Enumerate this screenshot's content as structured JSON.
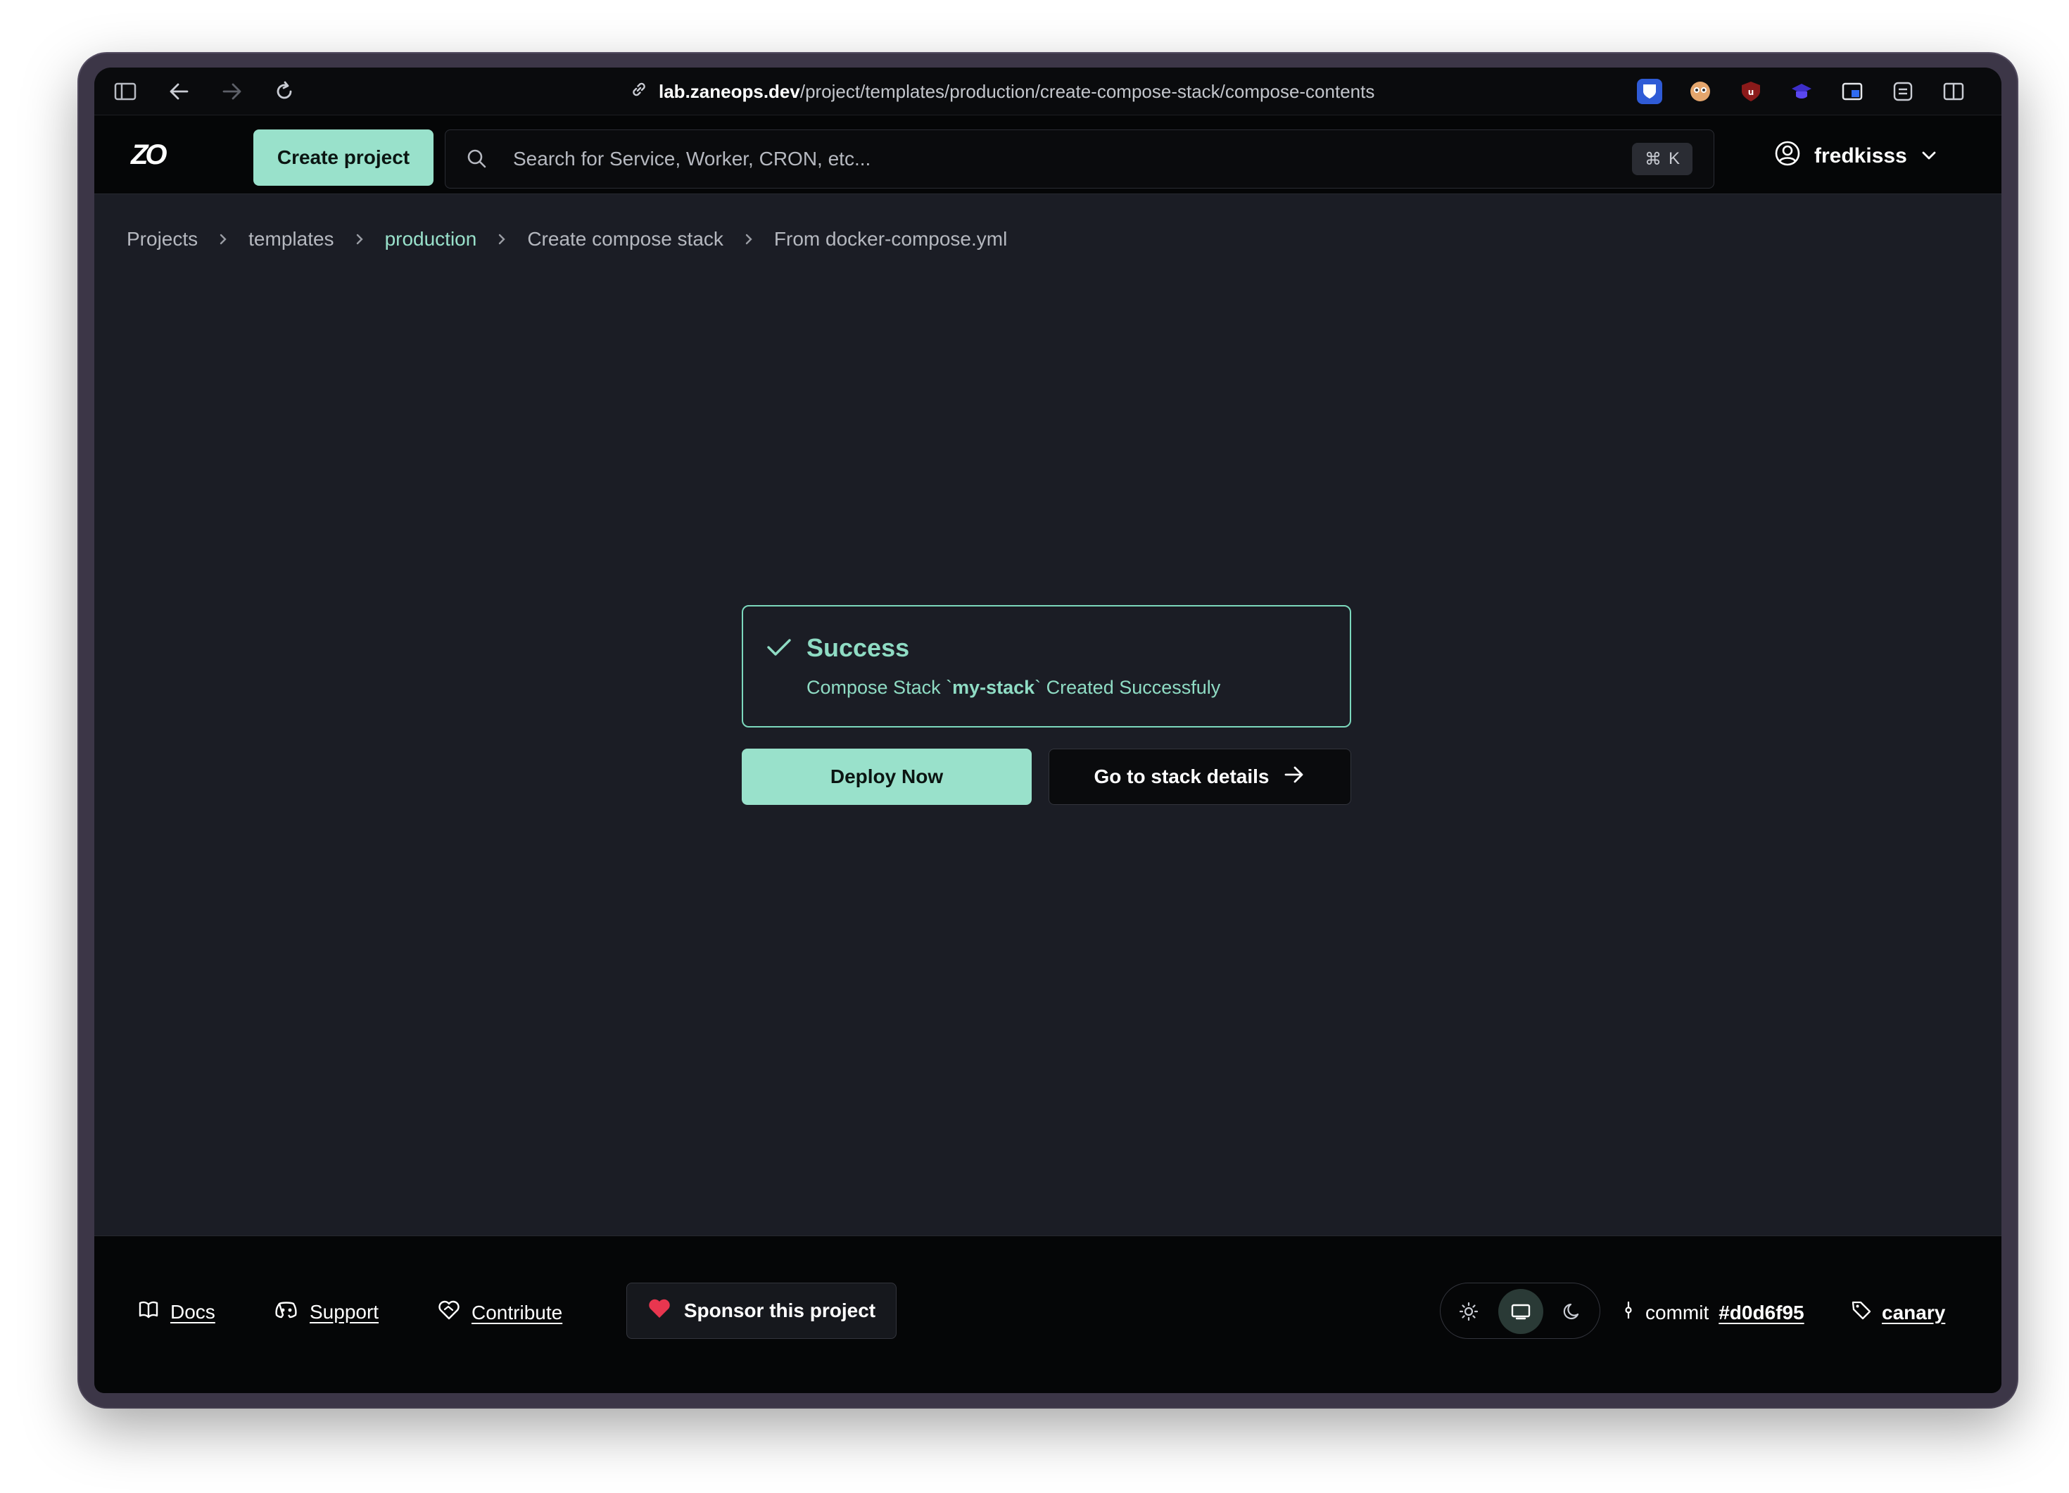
{
  "browser": {
    "url_host": "lab.zaneops.dev",
    "url_path": "/project/templates/production/create-compose-stack/compose-contents"
  },
  "header": {
    "logo_text": "ZO",
    "create_project_label": "Create project",
    "search_placeholder": "Search for Service, Worker, CRON, etc...",
    "search_shortcut": "K",
    "username": "fredkisss"
  },
  "breadcrumb": [
    {
      "label": "Projects"
    },
    {
      "label": "templates"
    },
    {
      "label": "production"
    },
    {
      "label": "Create compose stack"
    },
    {
      "label": "From docker-compose.yml"
    }
  ],
  "alert": {
    "title": "Success",
    "desc_prefix": "Compose Stack `",
    "stack_name": "my-stack",
    "desc_suffix": "` Created Successfuly"
  },
  "actions": {
    "deploy_label": "Deploy Now",
    "details_label": "Go to stack details"
  },
  "footer": {
    "docs_label": "Docs",
    "support_label": "Support",
    "contribute_label": "Contribute",
    "sponsor_label": "Sponsor this project",
    "commit_prefix": "commit",
    "commit_hash": "#d0d6f95",
    "channel": "canary"
  },
  "colors": {
    "accent": "#99e1cb",
    "background": "#1b1d25",
    "header_bg": "#050607",
    "heart": "#e8364f"
  }
}
